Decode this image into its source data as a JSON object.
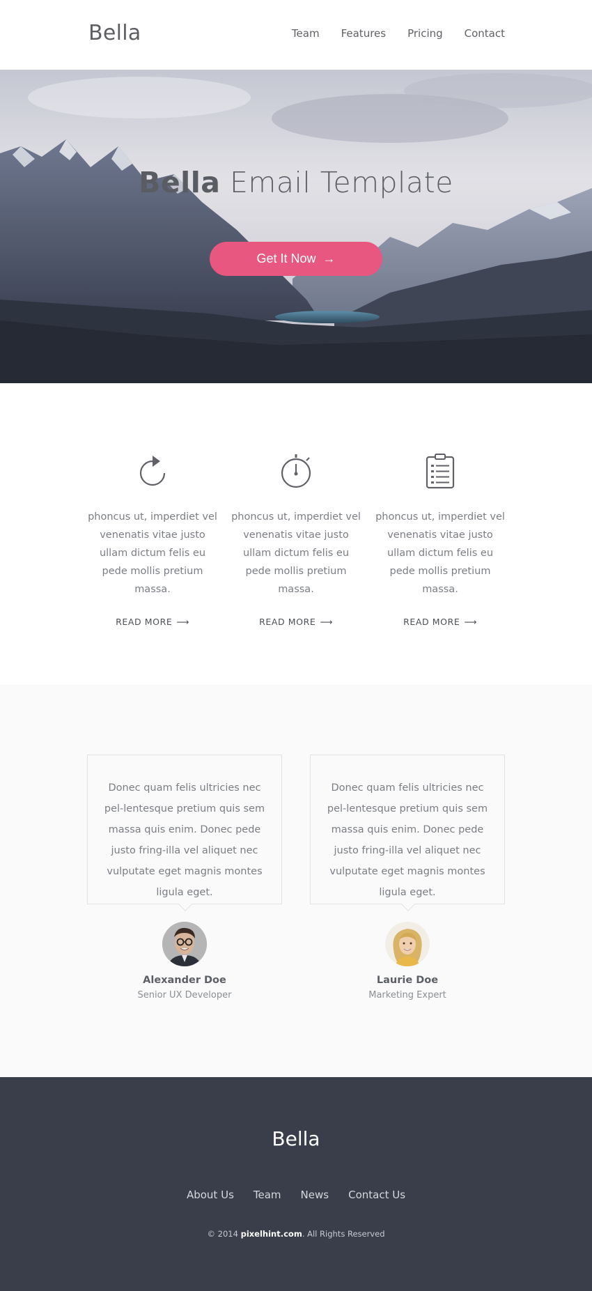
{
  "header": {
    "logo": "Bella",
    "nav": [
      "Team",
      "Features",
      "Pricing",
      "Contact"
    ]
  },
  "hero": {
    "title_bold": "Bella",
    "title_light": "Email Template",
    "cta_label": "Get It Now",
    "cta_arrow": "→"
  },
  "features": [
    {
      "icon": "refresh-icon",
      "text": "phoncus ut, imperdiet vel venenatis vitae justo ullam dictum felis eu pede mollis pretium massa.",
      "more": "READ MORE",
      "arrow": "⟶"
    },
    {
      "icon": "stopwatch-icon",
      "text": "phoncus ut, imperdiet vel venenatis vitae justo ullam dictum felis eu pede mollis pretium massa.",
      "more": "READ MORE",
      "arrow": "⟶"
    },
    {
      "icon": "clipboard-icon",
      "text": "phoncus ut, imperdiet vel venenatis vitae justo ullam dictum felis eu pede mollis pretium massa.",
      "more": "READ MORE",
      "arrow": "⟶"
    }
  ],
  "testimonials": [
    {
      "quote": "Donec quam felis ultricies nec pel-lentesque pretium quis sem massa quis enim. Donec pede justo fring-illa vel aliquet nec vulputate eget magnis montes ligula eget.",
      "name": "Alexander Doe",
      "role": "Senior UX Developer"
    },
    {
      "quote": "Donec quam felis ultricies nec pel-lentesque pretium quis sem massa quis enim. Donec pede justo fring-illa vel aliquet nec vulputate eget magnis montes ligula eget.",
      "name": "Laurie Doe",
      "role": "Marketing Expert"
    }
  ],
  "footer": {
    "logo": "Bella",
    "nav": [
      "About Us",
      "Team",
      "News",
      "Contact Us"
    ],
    "copy_prefix": "© 2014",
    "copy_site": "pixelhint.com",
    "copy_suffix": ". All Rights Reserved"
  },
  "colors": {
    "accent": "#e8577f",
    "footer_bg": "#3a3e4a",
    "testimonial_bg": "#fafafa"
  }
}
